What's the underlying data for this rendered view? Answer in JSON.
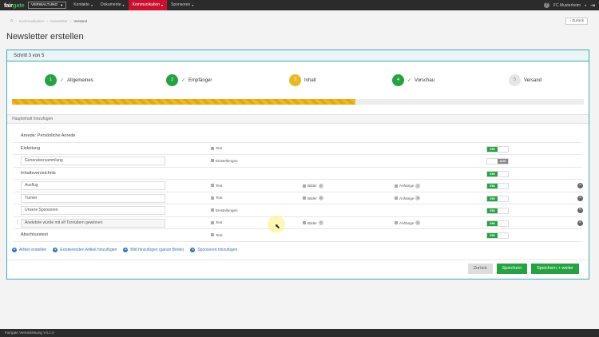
{
  "topbar": {
    "logo_main": "fair",
    "logo_accent": "gate",
    "role": "VERWALTUNG",
    "nav": [
      "Kontakte",
      "Dokumente",
      "Kommunikation",
      "Sponsoren"
    ],
    "active_nav": "Kommunikation",
    "help_icon": "?",
    "club": "FC Musterheim"
  },
  "breadcrumb": {
    "home_icon": "home-icon",
    "items": [
      "Kommunikation",
      "Newsletter",
      "Versand"
    ]
  },
  "back_button": "Zurück",
  "page_title": "Newsletter erstellen",
  "wizard": {
    "header": "Schritt 3 von 5",
    "steps": [
      {
        "num": "1",
        "label": "Allgemeines",
        "state": "done"
      },
      {
        "num": "2",
        "label": "Empfänger",
        "state": "done"
      },
      {
        "num": "3",
        "label": "Inhalt",
        "state": "current"
      },
      {
        "num": "4",
        "label": "Vorschau",
        "state": "done"
      },
      {
        "num": "5",
        "label": "Versand",
        "state": "todo"
      }
    ],
    "progress_fraction": 0.6
  },
  "section_label": "Hauptinhalt hinzufügen",
  "content": {
    "greeting": "Anrede: Persönliche Anrede",
    "einleitung": "Einleitung",
    "generalversammlung": "Generalversammlung",
    "inhaltsverzeichnis": "Inhaltsverzeichnis",
    "ausflug": "Ausflug",
    "turnier": "Turnier",
    "sponsoren": "Unsere Sponsoren",
    "anekdote": "Anekdote würde mit elf Tornüdern gewinnen",
    "abschluss": "Abschlusstext",
    "opt_text": "Text",
    "opt_einstellungen": "Einstellungen",
    "opt_bilder": "Bilder",
    "opt_anhaenge": "Anhänge",
    "badge_q": "?",
    "badge_0": "0",
    "ein": "EIN",
    "aus": "AUS"
  },
  "add_links": [
    "Artikel erstellen",
    "Existierenden Artikel hinzufügen",
    "Bild hinzufügen (ganze Breite)",
    "Sponsoren hinzufügen"
  ],
  "actions": {
    "back": "Zurück",
    "save": "Speichern",
    "save_next": "Speichern + weiter"
  },
  "footer": "Fairgate Vereinslösung V4.1.0",
  "colors": {
    "accent_teal": "#3fa9b9",
    "brand_red": "#c9102f",
    "success_green": "#27a243",
    "progress_yellow": "#f2b821"
  }
}
